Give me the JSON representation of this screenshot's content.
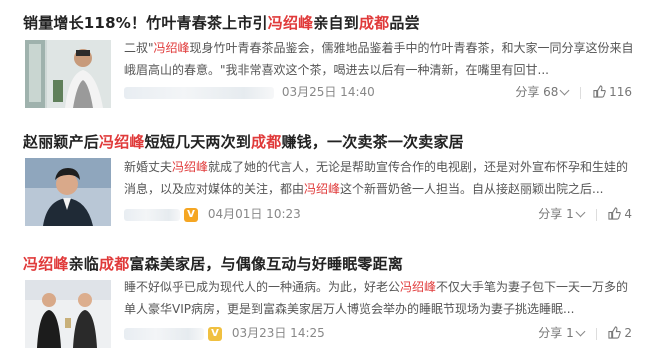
{
  "articles": [
    {
      "title_parts": [
        {
          "text": "销量增长118%！竹叶青春茶上市引",
          "hl": false
        },
        {
          "text": "冯绍峰",
          "hl": true
        },
        {
          "text": "亲自到",
          "hl": false
        },
        {
          "text": "成都",
          "hl": true
        },
        {
          "text": "品尝",
          "hl": false
        }
      ],
      "snippet_parts": [
        {
          "text": "二叔\"",
          "hl": false
        },
        {
          "text": "冯绍峰",
          "hl": true
        },
        {
          "text": "现身竹叶青春茶品鉴会，儒雅地品鉴着手中的竹叶青春茶，和大家一同分享这份来自峨眉高山的春意。\"我非常喜欢这个茶，喝进去以后有一种清新，在嘴里有回甘...",
          "hl": false
        }
      ],
      "date": "03月25日 14:40",
      "verified": false,
      "share": "分享 68",
      "likes": "116"
    },
    {
      "title_parts": [
        {
          "text": "赵丽颖产后",
          "hl": false
        },
        {
          "text": "冯绍峰",
          "hl": true
        },
        {
          "text": "短短几天两次到",
          "hl": false
        },
        {
          "text": "成都",
          "hl": true
        },
        {
          "text": "赚钱，一次卖茶一次卖家居",
          "hl": false
        }
      ],
      "snippet_parts": [
        {
          "text": "新婚丈夫",
          "hl": false
        },
        {
          "text": "冯绍峰",
          "hl": true
        },
        {
          "text": "就成了她的代言人，无论是帮助宣传合作的电视剧，还是对外宣布怀孕和生娃的消息，以及应对媒体的关注，都由",
          "hl": false
        },
        {
          "text": "冯绍峰",
          "hl": true
        },
        {
          "text": "这个新晋奶爸一人担当。自从接赵丽颖出院之后...",
          "hl": false
        }
      ],
      "date": "04月01日 10:23",
      "verified": true,
      "share": "分享 1",
      "likes": "4"
    },
    {
      "title_parts": [
        {
          "text": "冯绍峰",
          "hl": true
        },
        {
          "text": "亲临",
          "hl": false
        },
        {
          "text": "成都",
          "hl": true
        },
        {
          "text": "富森美家居，与偶像互动与好睡眠零距离",
          "hl": false
        }
      ],
      "snippet_parts": [
        {
          "text": "睡不好似乎已成为现代人的一种通病。为此，好老公",
          "hl": false
        },
        {
          "text": "冯绍峰",
          "hl": true
        },
        {
          "text": "不仅大手笔为妻子包下一天一万多的单人豪华VIP病房，更是到富森美家居万人博览会举办的睡眠节现场为妻子挑选睡眠...",
          "hl": false
        }
      ],
      "date": "03月23日 14:25",
      "verified": true,
      "share": "分享 1",
      "likes": "2"
    }
  ],
  "icons": {
    "thumbs_up": "thumbs-up-icon",
    "chevron": "chevron-down-icon",
    "verified": "verified-badge-icon"
  },
  "colors": {
    "highlight": "#e03a3a",
    "verified_badge": "#f5a623"
  }
}
